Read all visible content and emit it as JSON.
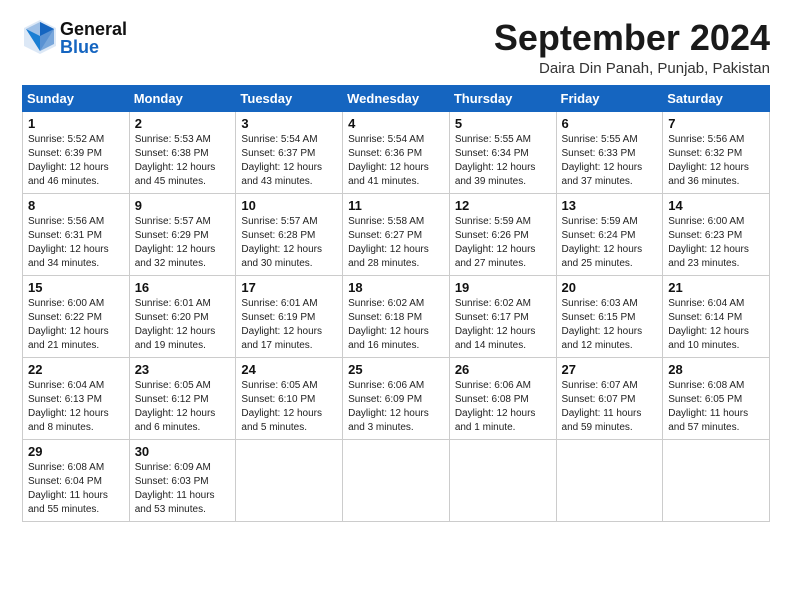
{
  "header": {
    "logo_general": "General",
    "logo_blue": "Blue",
    "month_title": "September 2024",
    "location": "Daira Din Panah, Punjab, Pakistan"
  },
  "weekdays": [
    "Sunday",
    "Monday",
    "Tuesday",
    "Wednesday",
    "Thursday",
    "Friday",
    "Saturday"
  ],
  "weeks": [
    [
      {
        "day": "1",
        "info": "Sunrise: 5:52 AM\nSunset: 6:39 PM\nDaylight: 12 hours\nand 46 minutes."
      },
      {
        "day": "2",
        "info": "Sunrise: 5:53 AM\nSunset: 6:38 PM\nDaylight: 12 hours\nand 45 minutes."
      },
      {
        "day": "3",
        "info": "Sunrise: 5:54 AM\nSunset: 6:37 PM\nDaylight: 12 hours\nand 43 minutes."
      },
      {
        "day": "4",
        "info": "Sunrise: 5:54 AM\nSunset: 6:36 PM\nDaylight: 12 hours\nand 41 minutes."
      },
      {
        "day": "5",
        "info": "Sunrise: 5:55 AM\nSunset: 6:34 PM\nDaylight: 12 hours\nand 39 minutes."
      },
      {
        "day": "6",
        "info": "Sunrise: 5:55 AM\nSunset: 6:33 PM\nDaylight: 12 hours\nand 37 minutes."
      },
      {
        "day": "7",
        "info": "Sunrise: 5:56 AM\nSunset: 6:32 PM\nDaylight: 12 hours\nand 36 minutes."
      }
    ],
    [
      {
        "day": "8",
        "info": "Sunrise: 5:56 AM\nSunset: 6:31 PM\nDaylight: 12 hours\nand 34 minutes."
      },
      {
        "day": "9",
        "info": "Sunrise: 5:57 AM\nSunset: 6:29 PM\nDaylight: 12 hours\nand 32 minutes."
      },
      {
        "day": "10",
        "info": "Sunrise: 5:57 AM\nSunset: 6:28 PM\nDaylight: 12 hours\nand 30 minutes."
      },
      {
        "day": "11",
        "info": "Sunrise: 5:58 AM\nSunset: 6:27 PM\nDaylight: 12 hours\nand 28 minutes."
      },
      {
        "day": "12",
        "info": "Sunrise: 5:59 AM\nSunset: 6:26 PM\nDaylight: 12 hours\nand 27 minutes."
      },
      {
        "day": "13",
        "info": "Sunrise: 5:59 AM\nSunset: 6:24 PM\nDaylight: 12 hours\nand 25 minutes."
      },
      {
        "day": "14",
        "info": "Sunrise: 6:00 AM\nSunset: 6:23 PM\nDaylight: 12 hours\nand 23 minutes."
      }
    ],
    [
      {
        "day": "15",
        "info": "Sunrise: 6:00 AM\nSunset: 6:22 PM\nDaylight: 12 hours\nand 21 minutes."
      },
      {
        "day": "16",
        "info": "Sunrise: 6:01 AM\nSunset: 6:20 PM\nDaylight: 12 hours\nand 19 minutes."
      },
      {
        "day": "17",
        "info": "Sunrise: 6:01 AM\nSunset: 6:19 PM\nDaylight: 12 hours\nand 17 minutes."
      },
      {
        "day": "18",
        "info": "Sunrise: 6:02 AM\nSunset: 6:18 PM\nDaylight: 12 hours\nand 16 minutes."
      },
      {
        "day": "19",
        "info": "Sunrise: 6:02 AM\nSunset: 6:17 PM\nDaylight: 12 hours\nand 14 minutes."
      },
      {
        "day": "20",
        "info": "Sunrise: 6:03 AM\nSunset: 6:15 PM\nDaylight: 12 hours\nand 12 minutes."
      },
      {
        "day": "21",
        "info": "Sunrise: 6:04 AM\nSunset: 6:14 PM\nDaylight: 12 hours\nand 10 minutes."
      }
    ],
    [
      {
        "day": "22",
        "info": "Sunrise: 6:04 AM\nSunset: 6:13 PM\nDaylight: 12 hours\nand 8 minutes."
      },
      {
        "day": "23",
        "info": "Sunrise: 6:05 AM\nSunset: 6:12 PM\nDaylight: 12 hours\nand 6 minutes."
      },
      {
        "day": "24",
        "info": "Sunrise: 6:05 AM\nSunset: 6:10 PM\nDaylight: 12 hours\nand 5 minutes."
      },
      {
        "day": "25",
        "info": "Sunrise: 6:06 AM\nSunset: 6:09 PM\nDaylight: 12 hours\nand 3 minutes."
      },
      {
        "day": "26",
        "info": "Sunrise: 6:06 AM\nSunset: 6:08 PM\nDaylight: 12 hours\nand 1 minute."
      },
      {
        "day": "27",
        "info": "Sunrise: 6:07 AM\nSunset: 6:07 PM\nDaylight: 11 hours\nand 59 minutes."
      },
      {
        "day": "28",
        "info": "Sunrise: 6:08 AM\nSunset: 6:05 PM\nDaylight: 11 hours\nand 57 minutes."
      }
    ],
    [
      {
        "day": "29",
        "info": "Sunrise: 6:08 AM\nSunset: 6:04 PM\nDaylight: 11 hours\nand 55 minutes."
      },
      {
        "day": "30",
        "info": "Sunrise: 6:09 AM\nSunset: 6:03 PM\nDaylight: 11 hours\nand 53 minutes."
      },
      null,
      null,
      null,
      null,
      null
    ]
  ]
}
